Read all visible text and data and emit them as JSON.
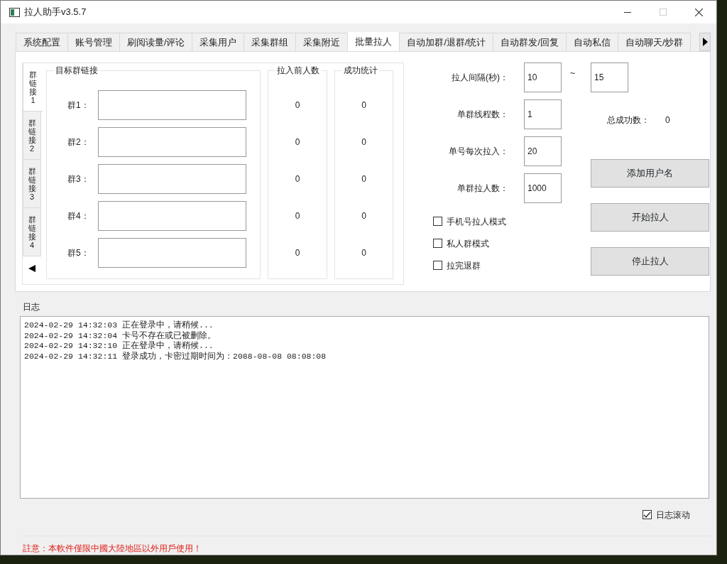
{
  "window": {
    "title": "拉人助手v3.5.7"
  },
  "tabs": [
    {
      "label": "系统配置",
      "selected": false
    },
    {
      "label": "账号管理",
      "selected": false
    },
    {
      "label": "刷阅读量/评论",
      "selected": false
    },
    {
      "label": "采集用户",
      "selected": false
    },
    {
      "label": "采集群组",
      "selected": false
    },
    {
      "label": "采集附近",
      "selected": false
    },
    {
      "label": "批量拉人",
      "selected": true
    },
    {
      "label": "自动加群/退群/统计",
      "selected": false
    },
    {
      "label": "自动群发/回复",
      "selected": false
    },
    {
      "label": "自动私信",
      "selected": false
    },
    {
      "label": "自动聊天/炒群",
      "selected": false
    }
  ],
  "link_tabs": [
    {
      "label": "群链接1",
      "selected": true
    },
    {
      "label": "群链接2",
      "selected": false
    },
    {
      "label": "群链接3",
      "selected": false
    },
    {
      "label": "群链接4",
      "selected": false
    }
  ],
  "target_group": {
    "title": "目标群链接",
    "rows": [
      {
        "label": "群1：",
        "before_count": "0",
        "success": "0"
      },
      {
        "label": "群2：",
        "before_count": "0",
        "success": "0"
      },
      {
        "label": "群3：",
        "before_count": "0",
        "success": "0"
      },
      {
        "label": "群4：",
        "before_count": "0",
        "success": "0"
      },
      {
        "label": "群5：",
        "before_count": "0",
        "success": "0"
      }
    ]
  },
  "before_column": {
    "title": "拉入前人数"
  },
  "success_column": {
    "title": "成功统计"
  },
  "settings": [
    {
      "label": "拉人间隔(秒)：",
      "value": "10"
    },
    {
      "label": "单群线程数：",
      "value": "1"
    },
    {
      "label": "单号每次拉入：",
      "value": "20"
    },
    {
      "label": "单群拉人数：",
      "value": "1000"
    }
  ],
  "interval_separator": "~",
  "interval_max": "15",
  "total": {
    "label": "总成功数：",
    "value": "0"
  },
  "buttons": [
    "添加用户名",
    "开始拉人",
    "停止拉人"
  ],
  "options": [
    {
      "label": "手机号拉人模式",
      "checked": false
    },
    {
      "label": "私人群模式",
      "checked": false
    },
    {
      "label": "拉完退群",
      "checked": false
    }
  ],
  "log": {
    "title": "日志",
    "lines": [
      "2024-02-29 14:32:03 正在登录中，请稍候...",
      "2024-02-29 14:32:04 卡号不存在或已被删除。",
      "2024-02-29 14:32:10 正在登录中，请稍候...",
      "2024-02-29 14:32:11 登录成功，卡密过期时间为：2088-08-08 08:08:08"
    ],
    "autoscroll": {
      "label": "日志滚动",
      "checked": true
    }
  },
  "notice": "註意：本軟件僅限中國大陸地區以外用戶使用！"
}
